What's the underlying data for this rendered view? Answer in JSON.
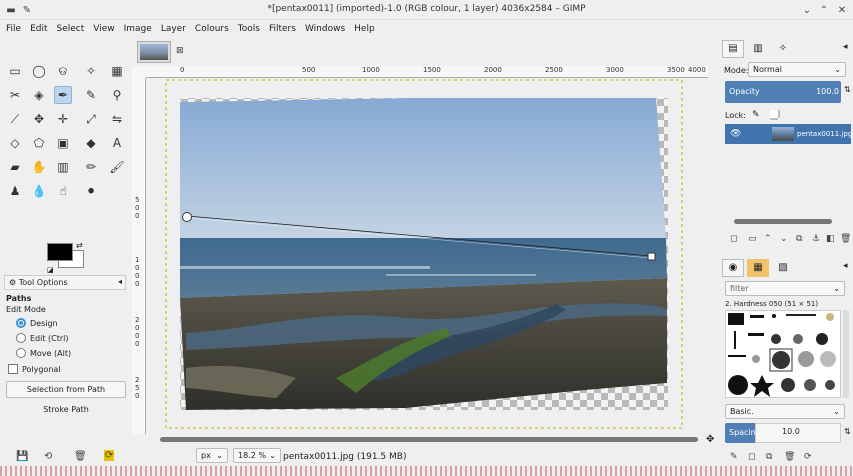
{
  "window": {
    "title": "*[pentax0011] (imported)-1.0 (RGB colour, 1 layer) 4036x2584 – GIMP"
  },
  "menu": [
    "File",
    "Edit",
    "Select",
    "View",
    "Image",
    "Layer",
    "Colours",
    "Tools",
    "Filters",
    "Windows",
    "Help"
  ],
  "toolbox": {
    "active_tool": "paths-tool",
    "tool_options_tab": "Tool Options",
    "section_title": "Paths",
    "edit_mode_label": "Edit Mode",
    "modes": [
      "Design",
      "Edit (Ctrl)",
      "Move (Alt)"
    ],
    "selected_mode": "Design",
    "polygonal_label": "Polygonal",
    "polygonal_checked": false,
    "selection_from_path": "Selection from Path",
    "stroke_path": "Stroke Path"
  },
  "canvas": {
    "ruler_labels": [
      "0",
      "500",
      "1000",
      "1500",
      "2000",
      "2500",
      "3000",
      "3500",
      "4000"
    ],
    "ruler_v_labels": [
      "5",
      "0",
      "0",
      "5",
      "0",
      "0",
      "1",
      "0",
      "0",
      "0",
      "1",
      "5",
      "0",
      "0",
      "2",
      "0",
      "0",
      "0",
      "2",
      "5",
      "0"
    ]
  },
  "status": {
    "unit": "px",
    "zoom": "18.2 %",
    "file_info": "pentax0011.jpg (191.5 MB)"
  },
  "layers": {
    "mode_label": "Mode:",
    "mode": "Normal",
    "opacity_label": "Opacity",
    "opacity_value": "100.0",
    "lock_label": "Lock:",
    "layer_name": "pentax0011.jpg"
  },
  "brushes": {
    "filter_placeholder": "filter",
    "brush_name": "2. Hardness 050 (51 × 51)",
    "preset": "Basic.",
    "spacing_label": "Spacing",
    "spacing_value": "10.0"
  },
  "colors": {
    "accent": "#4f7fb4",
    "sky_top": "#8fb1d8",
    "sea": "#3e5f80",
    "rocks": "#4a4a40"
  }
}
